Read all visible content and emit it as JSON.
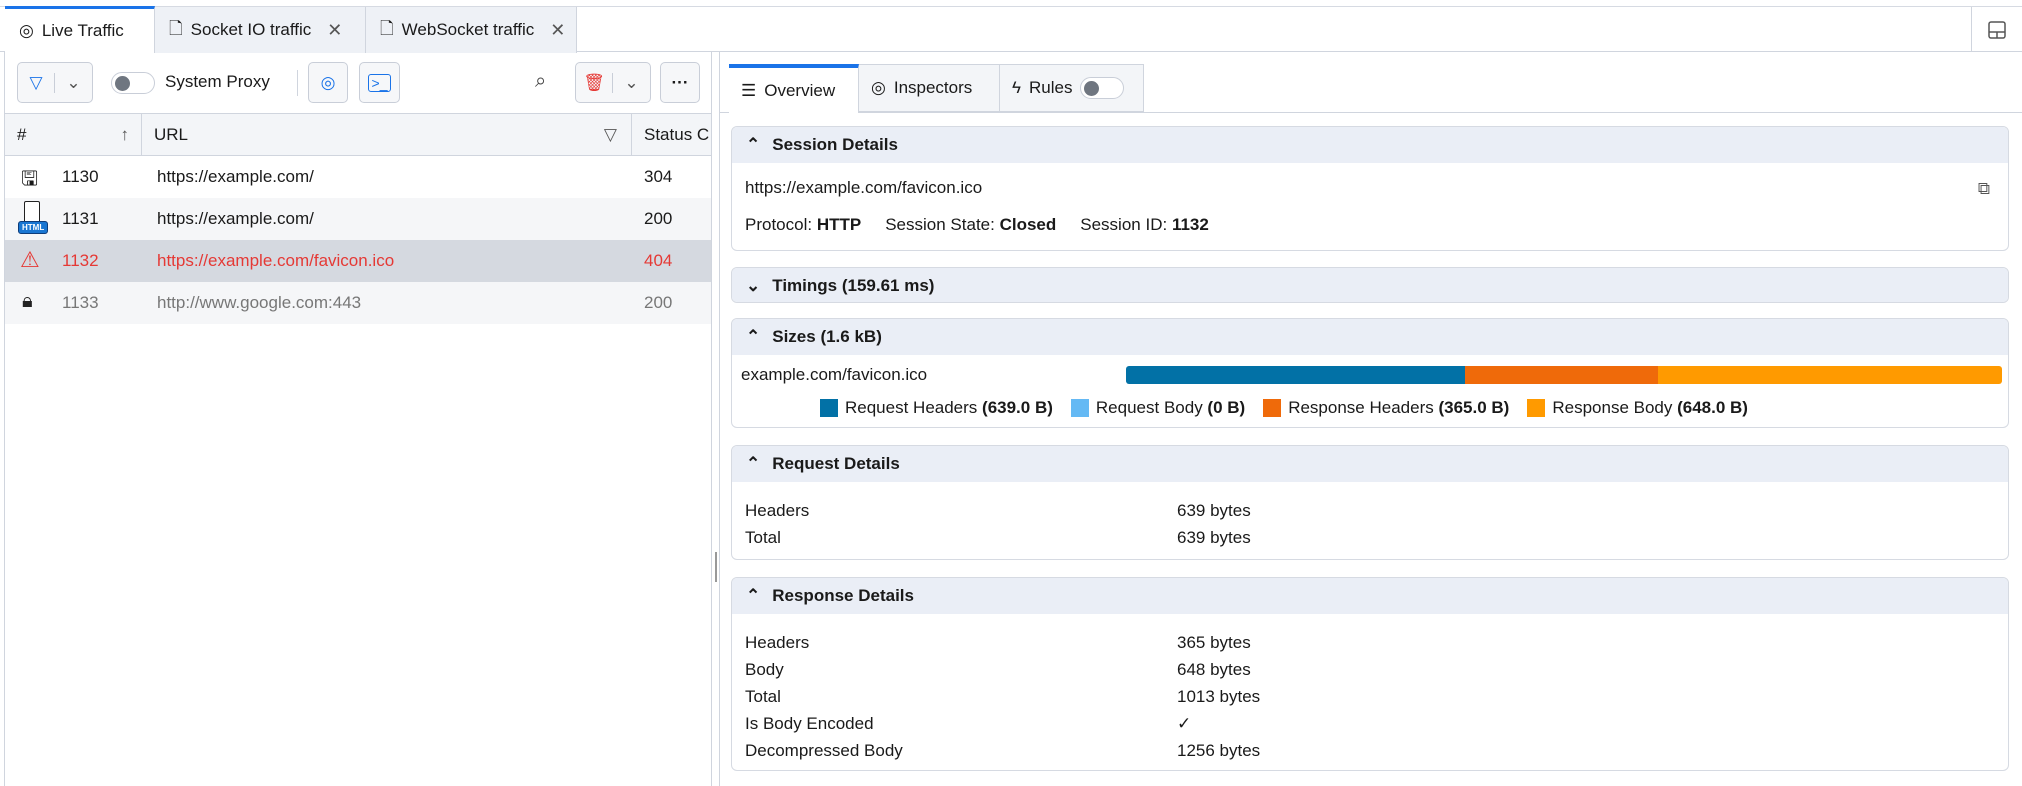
{
  "doc_tabs": [
    {
      "label": "Live Traffic"
    },
    {
      "label": "Socket IO traffic"
    },
    {
      "label": "WebSocket traffic"
    }
  ],
  "toolbar": {
    "system_proxy_label": "System Proxy",
    "system_proxy_on": false
  },
  "grid": {
    "columns": [
      "#",
      "URL",
      "Status C"
    ],
    "rows": [
      {
        "id": "1130",
        "url": "https://example.com/",
        "status": "304",
        "icon": "cache-icon"
      },
      {
        "id": "1131",
        "url": "https://example.com/",
        "status": "200",
        "icon": "html-file-icon",
        "badge": "HTML"
      },
      {
        "id": "1132",
        "url": "https://example.com/favicon.ico",
        "status": "404",
        "icon": "warning-icon"
      },
      {
        "id": "1133",
        "url": "http://www.google.com:443",
        "status": "200",
        "icon": "lock-icon"
      }
    ]
  },
  "inspector_tabs": [
    {
      "label": "Overview"
    },
    {
      "label": "Inspectors"
    },
    {
      "label": "Rules"
    }
  ],
  "session": {
    "title": "Session Details",
    "url": "https://example.com/favicon.ico",
    "protocol_label": "Protocol:",
    "protocol": "HTTP",
    "state_label": "Session State:",
    "state": "Closed",
    "id_label": "Session ID:",
    "id": "1132"
  },
  "timings": {
    "title": "Timings (159.61 ms)"
  },
  "sizes": {
    "title": "Sizes (1.6 kB)",
    "label": "example.com/favicon.ico",
    "segments": [
      {
        "name": "Request Headers",
        "value": "(639.0 B)",
        "bytes": 639,
        "color": "#0271a6"
      },
      {
        "name": "Request Body",
        "value": "(0 B)",
        "bytes": 0,
        "color": "#64b9f4"
      },
      {
        "name": "Response Headers",
        "value": "(365.0 B)",
        "bytes": 365,
        "color": "#ef6a0a"
      },
      {
        "name": "Response Body",
        "value": "(648.0 B)",
        "bytes": 648,
        "color": "#ff9a00"
      }
    ]
  },
  "request": {
    "title": "Request Details",
    "rows": [
      {
        "k": "Headers",
        "v": "639 bytes"
      },
      {
        "k": "Total",
        "v": "639 bytes"
      }
    ]
  },
  "response": {
    "title": "Response Details",
    "rows": [
      {
        "k": "Headers",
        "v": "365 bytes"
      },
      {
        "k": "Body",
        "v": "648 bytes"
      },
      {
        "k": "Total",
        "v": "1013 bytes"
      },
      {
        "k": "Is Body Encoded",
        "v": "✓"
      },
      {
        "k": "Decompressed Body",
        "v": "1256 bytes"
      }
    ]
  }
}
